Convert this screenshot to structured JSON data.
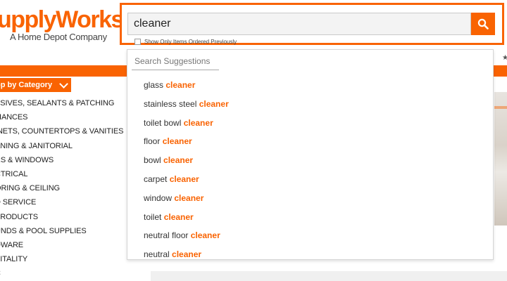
{
  "brand": {
    "logo_text": "upplyWorks",
    "logo_tm": "®",
    "tagline": "A Home Depot Company",
    "accent_color": "#f96302"
  },
  "search": {
    "value": "cleaner",
    "button_icon": "search-icon",
    "checkbox_label": "Show Only Items Ordered Previously"
  },
  "suggestions": {
    "heading": "Search Suggestions",
    "items": [
      {
        "prefix": "glass ",
        "match": "cleaner"
      },
      {
        "prefix": "stainless steel ",
        "match": "cleaner"
      },
      {
        "prefix": "toilet bowl ",
        "match": "cleaner"
      },
      {
        "prefix": "floor ",
        "match": "cleaner"
      },
      {
        "prefix": "bowl ",
        "match": "cleaner"
      },
      {
        "prefix": "carpet ",
        "match": "cleaner"
      },
      {
        "prefix": "window ",
        "match": "cleaner"
      },
      {
        "prefix": "toilet ",
        "match": "cleaner"
      },
      {
        "prefix": "neutral floor ",
        "match": "cleaner"
      },
      {
        "prefix": "neutral ",
        "match": "cleaner"
      }
    ]
  },
  "nav": {
    "shop_label": "op by Category",
    "header_icon": "star-icon",
    "categories": [
      "ESIVES, SEALANTS & PATCHING",
      "LIANCES",
      "INETS, COUNTERTOPS & VANITIES",
      "ANING & JANITORIAL",
      "RS & WINDOWS",
      "CTRICAL",
      "ORING & CEILING",
      "D SERVICE",
      "PRODUCTS",
      "UNDS & POOL SUPPLIES",
      "DWARE",
      "PITALITY",
      "C"
    ]
  }
}
